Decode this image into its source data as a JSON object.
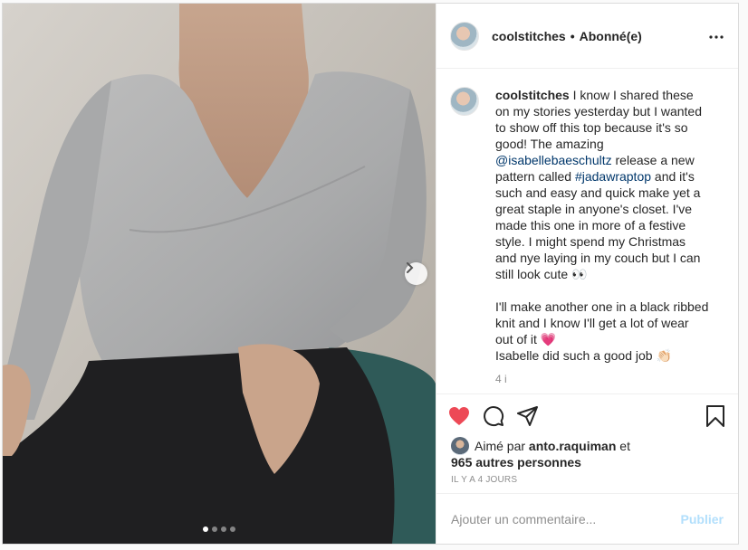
{
  "post": {
    "author": "coolstitches",
    "separator": "•",
    "follow_status": "Abonné(e)",
    "caption": {
      "username": "coolstitches",
      "text_1": " I know I shared these on my stories yesterday but I wanted to show off this top because it's so good! The amazing ",
      "mention": "@isabellebaeschultz",
      "text_2": " release a new pattern called ",
      "hashtag": "#jadawraptop",
      "text_3": " and it's such and easy and quick make yet a great staple in anyone's closet. I've made this one in more of a festive style. I might spend my Christmas and nye laying in my couch but I can still look cute 👀",
      "text_4": "I'll make another one in a black ribbed knit and I know I'll get a lot of wear out of it 💗",
      "text_5": "Isabelle did such a good job 👏🏻",
      "time": "4 i"
    },
    "likes": {
      "prefix": "Aimé par ",
      "user": "anto.raquiman",
      "conj": " et",
      "others": "965 autres personnes"
    },
    "posted_ago": "IL Y A 4 JOURS",
    "carousel": {
      "count": 4,
      "active_index": 0
    },
    "liked": true
  },
  "comment_box": {
    "placeholder": "Ajouter un commentaire...",
    "post_label": "Publier"
  },
  "icons": {
    "like": "heart-filled-icon",
    "comment": "comment-bubble-icon",
    "share": "paper-plane-icon",
    "save": "bookmark-icon",
    "more": "more-horizontal-icon",
    "next": "chevron-right-icon"
  },
  "colors": {
    "like_red": "#ed4956",
    "link_blue": "#00376b",
    "publish_disabled": "#b2dffc",
    "muted": "#8e8e8e"
  }
}
